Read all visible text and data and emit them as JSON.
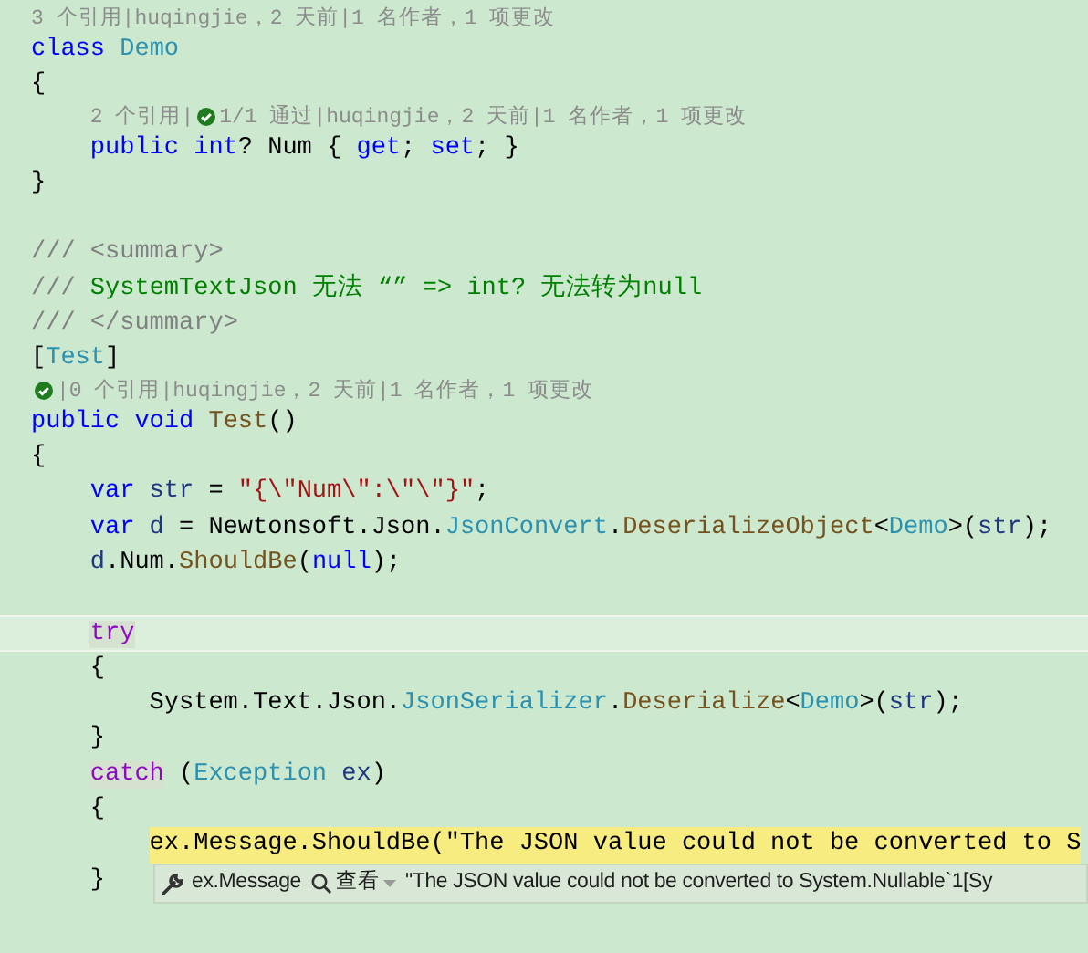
{
  "editor": {
    "lines": [
      {
        "kind": "lens",
        "parts": [
          {
            "kind": "text",
            "text": "3 个引用|huqingjie，2 天前|1 名作者，1 项更改"
          }
        ]
      },
      {
        "kind": "code",
        "current": false,
        "highlighted": false,
        "tokens": [
          {
            "kind": "kw",
            "t": "class"
          },
          {
            "kind": "type",
            "t": " Demo"
          }
        ]
      },
      {
        "kind": "code",
        "current": false,
        "highlighted": false,
        "tokens": [
          {
            "kind": "plain",
            "t": "{"
          }
        ]
      },
      {
        "kind": "lens",
        "parts": [
          {
            "kind": "text",
            "text": "    2 个引用|"
          },
          {
            "kind": "check"
          },
          {
            "kind": "text",
            "text": "1/1 通过|huqingjie，2 天前|1 名作者，1 项更改"
          }
        ]
      },
      {
        "kind": "code",
        "current": false,
        "highlighted": false,
        "tokens": [
          {
            "kind": "kw",
            "t": "    public int"
          },
          {
            "kind": "plain",
            "t": "? Num { "
          },
          {
            "kind": "kw",
            "t": "get"
          },
          {
            "kind": "plain",
            "t": "; "
          },
          {
            "kind": "kw",
            "t": "set"
          },
          {
            "kind": "plain",
            "t": "; }"
          }
        ]
      },
      {
        "kind": "code",
        "current": false,
        "highlighted": false,
        "tokens": [
          {
            "kind": "plain",
            "t": "}"
          }
        ]
      },
      {
        "kind": "blank"
      },
      {
        "kind": "code",
        "current": false,
        "highlighted": false,
        "tokens": [
          {
            "kind": "doc",
            "t": "/// <summary>"
          }
        ]
      },
      {
        "kind": "code",
        "current": false,
        "highlighted": false,
        "tokens": [
          {
            "kind": "doc",
            "t": "///"
          },
          {
            "kind": "cmt",
            "t": " SystemTextJson 无法 “” => int? 无法转为null"
          }
        ]
      },
      {
        "kind": "code",
        "current": false,
        "highlighted": false,
        "tokens": [
          {
            "kind": "doc",
            "t": "/// </summary>"
          }
        ]
      },
      {
        "kind": "code",
        "current": false,
        "highlighted": false,
        "tokens": [
          {
            "kind": "plain",
            "t": "["
          },
          {
            "kind": "type",
            "t": "Test"
          },
          {
            "kind": "plain",
            "t": "]"
          }
        ]
      },
      {
        "kind": "lens",
        "parts": [
          {
            "kind": "check"
          },
          {
            "kind": "text",
            "text": "|0 个引用|huqingjie，2 天前|1 名作者，1 项更改"
          }
        ]
      },
      {
        "kind": "code",
        "current": false,
        "highlighted": false,
        "tokens": [
          {
            "kind": "kw",
            "t": "public void"
          },
          {
            "kind": "method",
            "t": " Test"
          },
          {
            "kind": "plain",
            "t": "()"
          }
        ]
      },
      {
        "kind": "code",
        "current": false,
        "highlighted": false,
        "tokens": [
          {
            "kind": "plain",
            "t": "{"
          }
        ]
      },
      {
        "kind": "code",
        "current": false,
        "highlighted": false,
        "tokens": [
          {
            "kind": "kw",
            "t": "    var"
          },
          {
            "kind": "local",
            "t": " str"
          },
          {
            "kind": "plain",
            "t": " = "
          },
          {
            "kind": "str",
            "t": "\"{\\\"Num\\\":\\\"\\\"}\""
          },
          {
            "kind": "plain",
            "t": ";"
          }
        ]
      },
      {
        "kind": "code",
        "current": false,
        "highlighted": false,
        "tokens": [
          {
            "kind": "kw",
            "t": "    var"
          },
          {
            "kind": "local",
            "t": " d"
          },
          {
            "kind": "plain",
            "t": " = Newtonsoft.Json."
          },
          {
            "kind": "type",
            "t": "JsonConvert"
          },
          {
            "kind": "plain",
            "t": "."
          },
          {
            "kind": "method",
            "t": "DeserializeObject"
          },
          {
            "kind": "plain",
            "t": "<"
          },
          {
            "kind": "type",
            "t": "Demo"
          },
          {
            "kind": "plain",
            "t": ">("
          },
          {
            "kind": "local",
            "t": "str"
          },
          {
            "kind": "plain",
            "t": ");"
          }
        ]
      },
      {
        "kind": "code",
        "current": false,
        "highlighted": false,
        "tokens": [
          {
            "kind": "local",
            "t": "    d"
          },
          {
            "kind": "plain",
            "t": ".Num."
          },
          {
            "kind": "method",
            "t": "ShouldBe"
          },
          {
            "kind": "plain",
            "t": "("
          },
          {
            "kind": "kw",
            "t": "null"
          },
          {
            "kind": "plain",
            "t": ");"
          }
        ]
      },
      {
        "kind": "blank"
      },
      {
        "kind": "code",
        "current": true,
        "highlighted": false,
        "tokens": [
          {
            "kind": "ctrl",
            "t": "    try",
            "marked": true
          }
        ]
      },
      {
        "kind": "code",
        "current": false,
        "highlighted": false,
        "tokens": [
          {
            "kind": "plain",
            "t": "    {"
          }
        ]
      },
      {
        "kind": "code",
        "current": false,
        "highlighted": false,
        "tokens": [
          {
            "kind": "plain",
            "t": "        System.Text.Json."
          },
          {
            "kind": "type",
            "t": "JsonSerializer"
          },
          {
            "kind": "plain",
            "t": "."
          },
          {
            "kind": "method",
            "t": "Deserialize"
          },
          {
            "kind": "plain",
            "t": "<"
          },
          {
            "kind": "type",
            "t": "Demo"
          },
          {
            "kind": "plain",
            "t": ">("
          },
          {
            "kind": "local",
            "t": "str"
          },
          {
            "kind": "plain",
            "t": ");"
          }
        ]
      },
      {
        "kind": "code",
        "current": false,
        "highlighted": false,
        "tokens": [
          {
            "kind": "plain",
            "t": "    }"
          }
        ]
      },
      {
        "kind": "code",
        "current": false,
        "highlighted": false,
        "tokens": [
          {
            "kind": "ctrl",
            "t": "    catch",
            "marked": true
          },
          {
            "kind": "plain",
            "t": " ("
          },
          {
            "kind": "type",
            "t": "Exception"
          },
          {
            "kind": "local",
            "t": " ex"
          },
          {
            "kind": "plain",
            "t": ")"
          }
        ]
      },
      {
        "kind": "code",
        "current": false,
        "highlighted": false,
        "tokens": [
          {
            "kind": "plain",
            "t": "    {"
          }
        ]
      },
      {
        "kind": "code",
        "current": false,
        "highlighted": true,
        "tokens": [
          {
            "kind": "plain",
            "t": "        ex.Message.ShouldBe(\"The JSON value could not be converted to S"
          }
        ]
      },
      {
        "kind": "code",
        "current": false,
        "highlighted": false,
        "tokens": [
          {
            "kind": "plain",
            "t": "    }"
          }
        ]
      }
    ]
  },
  "data_tip": {
    "expression": "ex.Message",
    "view_label": "查看",
    "value": "\"The JSON value could not be converted to System.Nullable`1[Sy"
  }
}
